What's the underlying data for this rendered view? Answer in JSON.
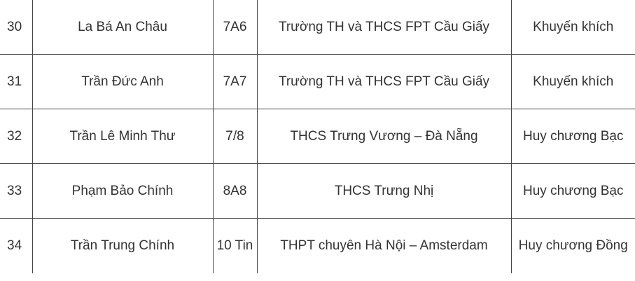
{
  "rows": [
    {
      "no": "30",
      "name": "La Bá An Châu",
      "class": "7A6",
      "school": "Trường TH và THCS FPT Cầu Giấy",
      "award": "Khuyến khích"
    },
    {
      "no": "31",
      "name": "Trần Đức Anh",
      "class": "7A7",
      "school": "Trường TH và THCS FPT Cầu Giấy",
      "award": "Khuyến khích"
    },
    {
      "no": "32",
      "name": "Trần Lê Minh Thư",
      "class": "7/8",
      "school": "THCS Trưng Vương – Đà Nẵng",
      "award": "Huy chương Bạc"
    },
    {
      "no": "33",
      "name": "Phạm Bảo Chính",
      "class": "8A8",
      "school": "THCS Trưng Nhị",
      "award": "Huy chương Bạc"
    },
    {
      "no": "34",
      "name": "Trần Trung Chính",
      "class": "10 Tin",
      "school": "THPT chuyên Hà Nội – Amsterdam",
      "award": "Huy chương Đồng"
    }
  ]
}
